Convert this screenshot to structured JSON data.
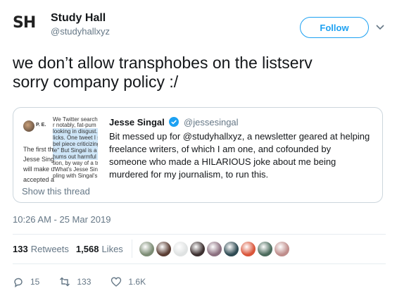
{
  "header": {
    "logo_text": "SH",
    "display_name": "Study Hall",
    "handle": "@studyhallxyz",
    "follow_label": "Follow"
  },
  "tweet": {
    "line1": "we don’t allow transphobes on the listserv",
    "line2": "sorry company policy :/"
  },
  "quote": {
    "author_name": "Jesse Singal",
    "author_handle": "@jessesingal",
    "text": "Bit messed up for @studyhallxyz,  a newsletter geared at helping freelance writers, of which I am one, and cofounded by someone who made a HILARIOUS joke about me being murdered for my journalism, to run this.",
    "show_thread": "Show this thread",
    "thumbnail": {
      "initials": "P. E.",
      "lines": [
        "We Twitter search p",
        "r notably, fat-pum",
        "looking in disgust. In",
        "licks. One tweet I s",
        "bel piece criticizing",
        "The first thi",
        "le\" But Singal is a p",
        "hums out harmful w",
        "Jesse Sing",
        "tion, by way of a tre",
        "will make u",
        "\"What's Jesse Sin",
        "pling with Singal's",
        "accepted a"
      ]
    }
  },
  "timestamp": "10:26 AM - 25 Mar 2019",
  "stats": {
    "retweets_count": "133",
    "retweets_label": "Retweets",
    "likes_count": "1,568",
    "likes_label": "Likes"
  },
  "liker_avatars": [
    "#7c8c74",
    "#5a3d33",
    "#dfe2e2",
    "#3c2f2f",
    "#8b6f7f",
    "#2e4a52",
    "#d9553a",
    "#4b6b5c",
    "#bf8d8b"
  ],
  "actions": {
    "replies": "15",
    "retweets": "133",
    "likes": "1.6K"
  },
  "colors": {
    "accent": "#1da1f2",
    "muted": "#657786",
    "border": "#ccd6dd",
    "text": "#14171a"
  }
}
